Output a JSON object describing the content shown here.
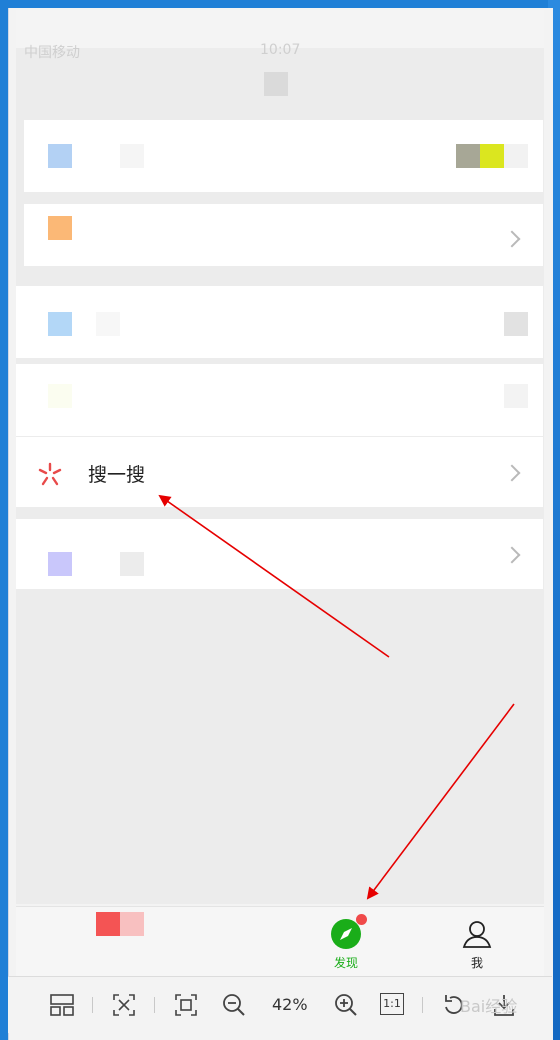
{
  "status": {
    "carrier": "中国移动",
    "time": "10:07"
  },
  "menu": {
    "search_label": "搜一搜"
  },
  "tabbar": {
    "discover_label": "发现",
    "me_label": "我"
  },
  "toolbar": {
    "zoom_level": "42%",
    "actual_size_label": "1:1"
  },
  "watermark": "Bai经验",
  "colors": {
    "wechat_green": "#1aad19",
    "badge_red": "#f04a4a",
    "arrow_red": "#e60000"
  }
}
